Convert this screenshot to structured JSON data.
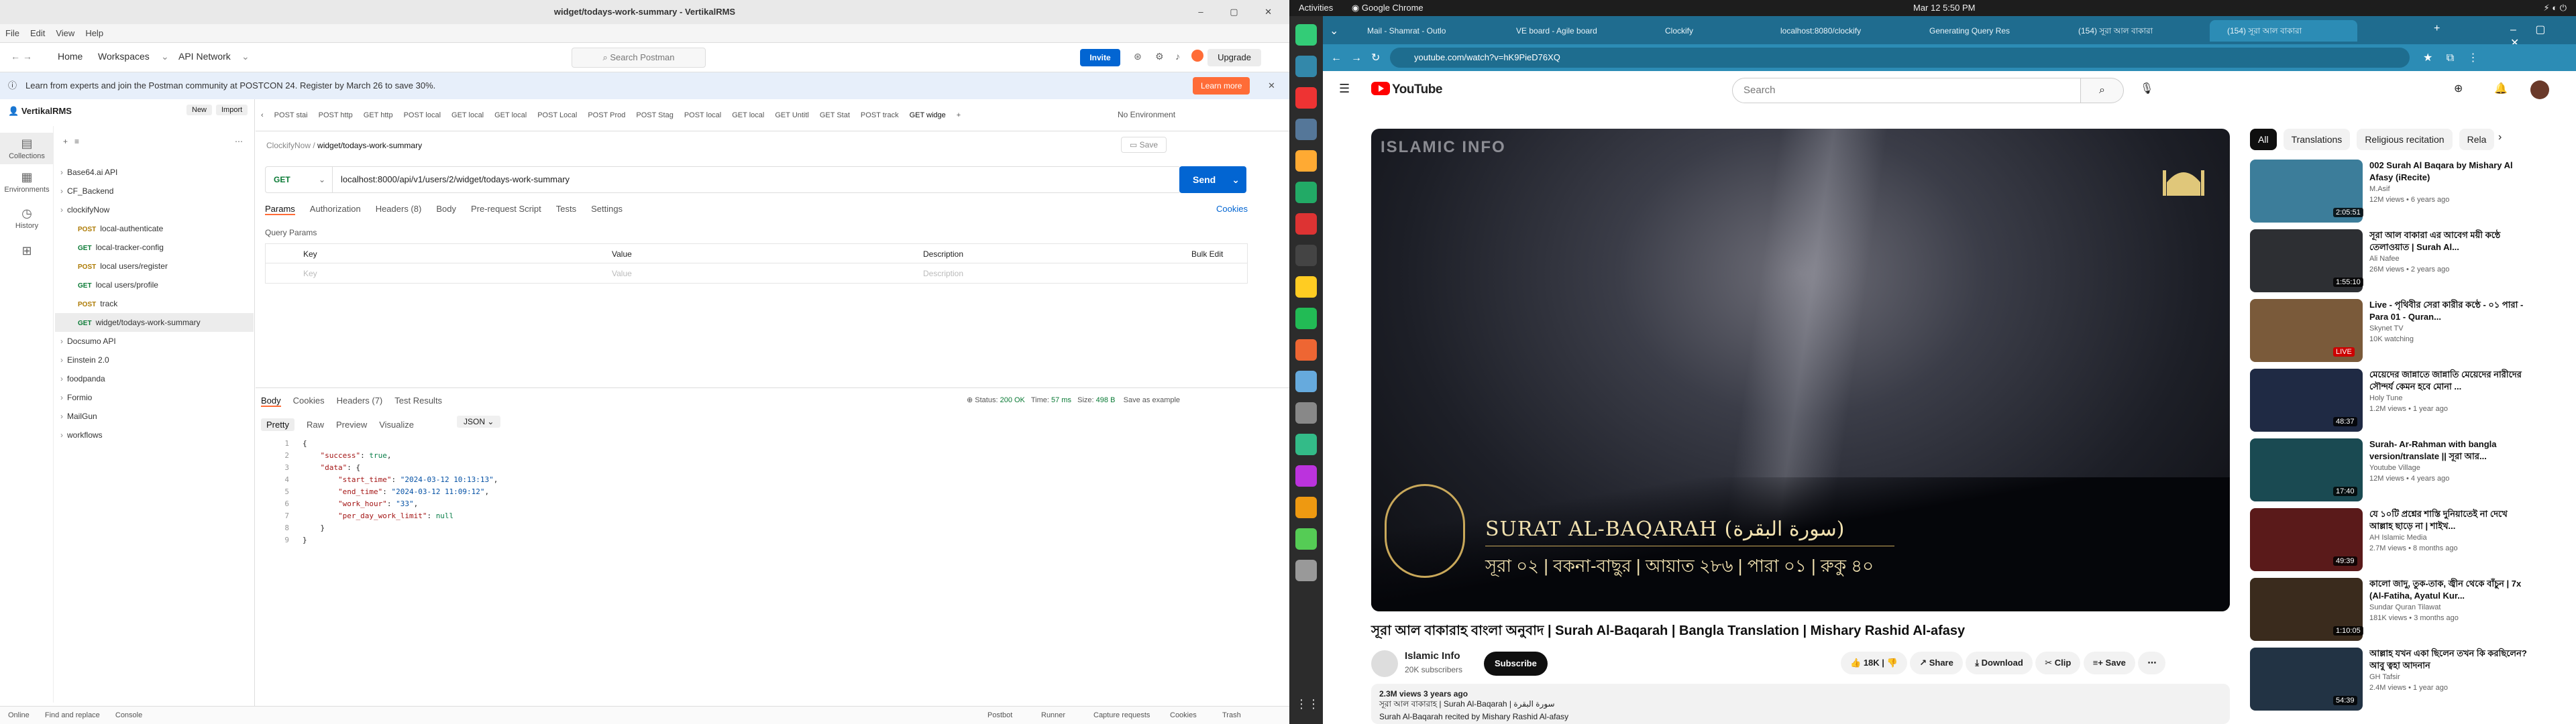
{
  "postman": {
    "window_title": "widget/todays-work-summary - VertikalRMS",
    "menu": [
      "File",
      "Edit",
      "View",
      "Help"
    ],
    "nav": {
      "home": "Home",
      "workspaces": "Workspaces",
      "api_network": "API Network",
      "search": "Search Postman",
      "invite": "Invite",
      "upgrade": "Upgrade"
    },
    "banner": {
      "text": "Learn from experts and join the Postman community at POSTCON 24. Register by March 26 to save 30%.",
      "button": "Learn more"
    },
    "workspace": {
      "name": "VertikalRMS",
      "new": "New",
      "import": "Import"
    },
    "rail": [
      "Collections",
      "Environments",
      "History"
    ],
    "tree": [
      {
        "label": "Base64.ai API",
        "level": 0
      },
      {
        "label": "CF_Backend",
        "level": 0
      },
      {
        "label": "clockifyNow",
        "level": 0
      },
      {
        "method": "POST",
        "label": "local-authenticate",
        "level": 1
      },
      {
        "method": "GET",
        "label": "local-tracker-config",
        "level": 1
      },
      {
        "method": "POST",
        "label": "local users/register",
        "level": 1
      },
      {
        "method": "GET",
        "label": "local users/profile",
        "level": 1
      },
      {
        "method": "POST",
        "label": "track",
        "level": 1
      },
      {
        "method": "GET",
        "label": "widget/todays-work-summary",
        "level": 1
      },
      {
        "label": "Docsumo API",
        "level": 0
      },
      {
        "label": "Einstein 2.0",
        "level": 0
      },
      {
        "label": "foodpanda",
        "level": 0
      },
      {
        "label": "Formio",
        "level": 0
      },
      {
        "label": "MailGun",
        "level": 0
      },
      {
        "label": "workflows",
        "level": 0
      }
    ],
    "tabs": [
      "POST stai",
      "POST http",
      "GET http",
      "POST local",
      "GET local",
      "GET local",
      "POST Local",
      "POST Prod",
      "POST Stag",
      "POST local",
      "GET local",
      "GET Untitl",
      "GET Stat",
      "POST track",
      "GET widge"
    ],
    "no_env": "No Environment",
    "breadcrumb": {
      "collection": "ClockifyNow",
      "request": "widget/todays-work-summary"
    },
    "save": "Save",
    "request": {
      "method": "GET",
      "url": "localhost:8000/api/v1/users/2/widget/todays-work-summary",
      "send": "Send"
    },
    "req_tabs": [
      "Params",
      "Authorization",
      "Headers (8)",
      "Body",
      "Pre-request Script",
      "Tests",
      "Settings"
    ],
    "cookies": "Cookies",
    "query_params": "Query Params",
    "kv_head": {
      "key": "Key",
      "value": "Value",
      "desc": "Description",
      "bulk": "Bulk Edit"
    },
    "kv_placeholder": {
      "key": "Key",
      "value": "Value",
      "desc": "Description"
    },
    "resp_tabs": [
      "Body",
      "Cookies",
      "Headers (7)",
      "Test Results"
    ],
    "resp_meta": {
      "status": "200 OK",
      "time": "57 ms",
      "size": "498 B",
      "save": "Save as example"
    },
    "view_tabs": [
      "Pretty",
      "Raw",
      "Preview",
      "Visualize"
    ],
    "format": "JSON",
    "code_lines": [
      "{",
      "    \"success\": true,",
      "    \"data\": {",
      "        \"start_time\": \"2024-03-12 10:13:13\",",
      "        \"end_time\": \"2024-03-12 11:09:12\",",
      "        \"work_hour\": \"33\",",
      "        \"per_day_work_limit\": null",
      "    }",
      "}"
    ],
    "status_left": [
      "Online",
      "Find and replace",
      "Console"
    ],
    "status_right": [
      "Postbot",
      "Runner",
      "Capture requests",
      "Cookies",
      "Trash"
    ]
  },
  "gnome": {
    "activities": "Activities",
    "app": "Google Chrome",
    "clock": "Mar 12  5:50 PM"
  },
  "chrome": {
    "tabs": [
      "Mail - Shamrat - Outlo",
      "VE board - Agile board",
      "Clockify",
      "localhost:8080/clockify",
      "Generating Query Res",
      "(154) সূরা আল বাকারা",
      "(154) সূরা আল বাকারা"
    ],
    "url": "youtube.com/watch?v=hK9PieD76XQ"
  },
  "youtube": {
    "search": "Search",
    "chips": [
      "All",
      "Translations",
      "Religious recitation",
      "Rela"
    ],
    "video": {
      "watermark": "ISLAMIC INFO",
      "overlay_en": "SURAT AL-BAQARAH",
      "overlay_ar": "(سورة البقرة)",
      "overlay_bn": "সূরা ০২ | বকনা-বাছুর | আয়াত ২৮৬ | পারা ০১ | রুকু ৪০",
      "title": "সূরা আল বাকারাহ বাংলা অনুবাদ | Surah Al-Baqarah | Bangla Translation | Mishary Rashid Al-afasy",
      "channel": "Islamic Info",
      "subs": "20K subscribers",
      "subscribe": "Subscribe",
      "likes": "18K",
      "share": "Share",
      "download": "Download",
      "clip": "Clip",
      "save": "Save",
      "views": "2.3M views  3 years ago",
      "desc1": "সূরা আল বাকারাহ | Surah Al-Baqarah | سورة البقرة",
      "desc2": "Surah Al-Baqarah recited by Mishary Rashid Al-afasy"
    },
    "recs": [
      {
        "title": "002 Surah Al Baqara by Mishary Al Afasy (iRecite)",
        "channel": "M.Asif",
        "meta": "12M views • 6 years ago",
        "dur": "2:05:51",
        "color": "#3c7d9a"
      },
      {
        "title": "সূরা আল বাকারা এর আবেগ ময়ী কন্ঠে তেলাওয়াত | Surah Al...",
        "channel": "Ali Nafee",
        "meta": "26M views • 2 years ago",
        "dur": "1:55:10",
        "color": "#2d2f33"
      },
      {
        "title": "Live - পৃথিবীর সেরা কারীর কন্ঠে - ০১ পারা - Para 01 - Quran...",
        "channel": "Skynet TV",
        "meta": "10K watching",
        "dur": "LIVE",
        "color": "#7a5a3a"
      },
      {
        "title": "মেয়েদের জান্নাতে জান্নাতি মেয়েদের নারীদের সৌন্দর্য কেমন হবে মোনা ...",
        "channel": "Holy Tune",
        "meta": "1.2M views • 1 year ago",
        "dur": "48:37",
        "color": "#1f2a44"
      },
      {
        "title": "Surah- Ar-Rahman with bangla version/translate || সূরা আর...",
        "channel": "Youtube Village",
        "meta": "12M views • 4 years ago",
        "dur": "17:40",
        "color": "#1a4a52"
      },
      {
        "title": "যে ১০টি প্রশ্নের শাস্তি দুনিয়াতেই না দেখে আল্লাহ ছাড়ে না | শাইখ...",
        "channel": "AH Islamic Media",
        "meta": "2.7M views • 8 months ago",
        "dur": "49:39",
        "color": "#5a1a1a"
      },
      {
        "title": "কালো জাদু, তুক-তাক, জ্বীন থেকে বাঁচুন | 7x (Al-Fatiha, Ayatul Kur...",
        "channel": "Sundar Quran Tilawat",
        "meta": "181K views • 3 months ago",
        "dur": "1:10:05",
        "color": "#3a2b1d"
      },
      {
        "title": "আল্লাহ যখন একা ছিলেন তখন কি করছিলেন? আবু ত্বহা আদনান",
        "channel": "GH Tafsir",
        "meta": "2.4M views • 1 year ago",
        "dur": "54:39",
        "color": "#223344"
      }
    ]
  }
}
